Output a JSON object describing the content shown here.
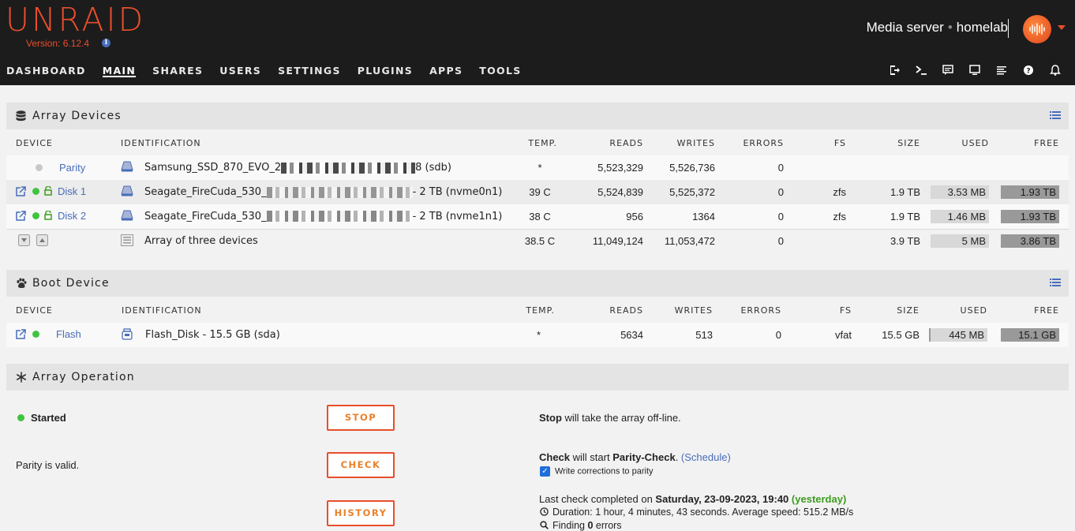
{
  "header": {
    "logo": "UNRAID",
    "version": "Version: 6.12.4",
    "server_name": "Media server",
    "separator": "•",
    "server_desc": "homelab"
  },
  "nav": [
    "DASHBOARD",
    "MAIN",
    "SHARES",
    "USERS",
    "SETTINGS",
    "PLUGINS",
    "APPS",
    "TOOLS"
  ],
  "nav_active": "MAIN",
  "toolbar_icons": [
    "logout-icon",
    "terminal-icon",
    "feedback-icon",
    "display-icon",
    "log-icon",
    "help-icon",
    "bell-icon"
  ],
  "array": {
    "title": "Array Devices",
    "columns": [
      "DEVICE",
      "IDENTIFICATION",
      "TEMP.",
      "READS",
      "WRITES",
      "ERRORS",
      "FS",
      "SIZE",
      "USED",
      "FREE"
    ],
    "rows": [
      {
        "device": "Parity",
        "id_prefix": "Samsung_SSD_870_EVO_2",
        "id_suffix": "8 (sdb)",
        "temp": "*",
        "reads": "5,523,329",
        "writes": "5,526,736",
        "errors": "0",
        "fs": "",
        "size": "",
        "used": "",
        "free": ""
      },
      {
        "device": "Disk 1",
        "id_prefix": "Seagate_FireCuda_530_",
        "id_suffix": "- 2 TB (nvme0n1)",
        "temp": "39 C",
        "reads": "5,524,839",
        "writes": "5,525,372",
        "errors": "0",
        "fs": "zfs",
        "size": "1.9 TB",
        "used": "3.53 MB",
        "free": "1.93 TB"
      },
      {
        "device": "Disk 2",
        "id_prefix": "Seagate_FireCuda_530_",
        "id_suffix": "- 2 TB (nvme1n1)",
        "temp": "38 C",
        "reads": "956",
        "writes": "1364",
        "errors": "0",
        "fs": "zfs",
        "size": "1.9 TB",
        "used": "1.46 MB",
        "free": "1.93 TB"
      }
    ],
    "summary": {
      "label": "Array of three devices",
      "temp": "38.5 C",
      "reads": "11,049,124",
      "writes": "11,053,472",
      "errors": "0",
      "size": "3.9 TB",
      "used": "5 MB",
      "free": "3.86 TB"
    }
  },
  "boot": {
    "title": "Boot Device",
    "columns": [
      "DEVICE",
      "IDENTIFICATION",
      "TEMP.",
      "READS",
      "WRITES",
      "ERRORS",
      "FS",
      "SIZE",
      "USED",
      "FREE"
    ],
    "row": {
      "device": "Flash",
      "id": "Flash_Disk - 15.5 GB (sda)",
      "temp": "*",
      "reads": "5634",
      "writes": "513",
      "errors": "0",
      "fs": "vfat",
      "size": "15.5 GB",
      "used": "445 MB",
      "free": "15.1 GB"
    }
  },
  "operation": {
    "title": "Array Operation",
    "status": "Started",
    "parity": "Parity is valid.",
    "stop_btn": "STOP",
    "check_btn": "CHECK",
    "history_btn": "HISTORY",
    "stop_b": "Stop",
    "stop_text": " will take the array off-line.",
    "check_b": "Check",
    "check_text": " will start ",
    "check_b2": "Parity-Check",
    "check_end": ". ",
    "schedule": "(Schedule)",
    "write_corr": "Write corrections to parity",
    "last_check": "Last check completed on ",
    "last_date": "Saturday, 23-09-2023, 19:40",
    "yesterday": "(yesterday)",
    "duration": "Duration: 1 hour, 4 minutes, 43 seconds. Average speed: 515.2 MB/s",
    "finding_pre": "Finding ",
    "finding_num": "0",
    "finding_post": " errors"
  },
  "colors": {
    "brand": "#e94e2b",
    "link": "#486dba",
    "ok": "#3fc43f"
  }
}
